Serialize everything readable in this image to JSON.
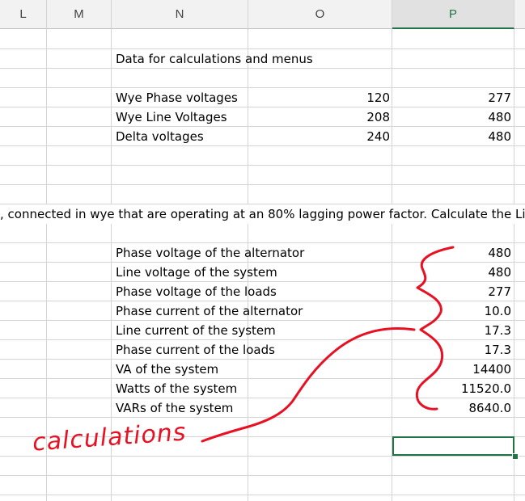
{
  "columns": [
    {
      "label": "L"
    },
    {
      "label": "M"
    },
    {
      "label": "N"
    },
    {
      "label": "O"
    },
    {
      "label": "P"
    }
  ],
  "menu_data": {
    "title": "Data for calculations and menus",
    "rows": [
      {
        "label": "Wye Phase voltages",
        "o": "120",
        "p": "277"
      },
      {
        "label": "Wye Line Voltages",
        "o": "208",
        "p": "480"
      },
      {
        "label": "Delta voltages",
        "o": "240",
        "p": "480"
      }
    ]
  },
  "problem_text": ", connected in wye that are operating at an 80% lagging power factor.  Calculate the Line",
  "calculations": [
    {
      "label": "Phase voltage of the alternator",
      "value": "480"
    },
    {
      "label": "Line voltage of the system",
      "value": "480"
    },
    {
      "label": "Phase voltage of the loads",
      "value": "277"
    },
    {
      "label": "Phase current of the alternator",
      "value": "10.0"
    },
    {
      "label": "Line current of the system",
      "value": "17.3"
    },
    {
      "label": "Phase current of the loads",
      "value": "17.3"
    },
    {
      "label": "VA of the system",
      "value": "14400"
    },
    {
      "label": "Watts of the system",
      "value": "11520.0"
    },
    {
      "label": "VARs of the system",
      "value": "8640.0"
    }
  ],
  "annotation": {
    "text": "calculations",
    "color": "#e81123"
  },
  "selection_color": "#217346"
}
